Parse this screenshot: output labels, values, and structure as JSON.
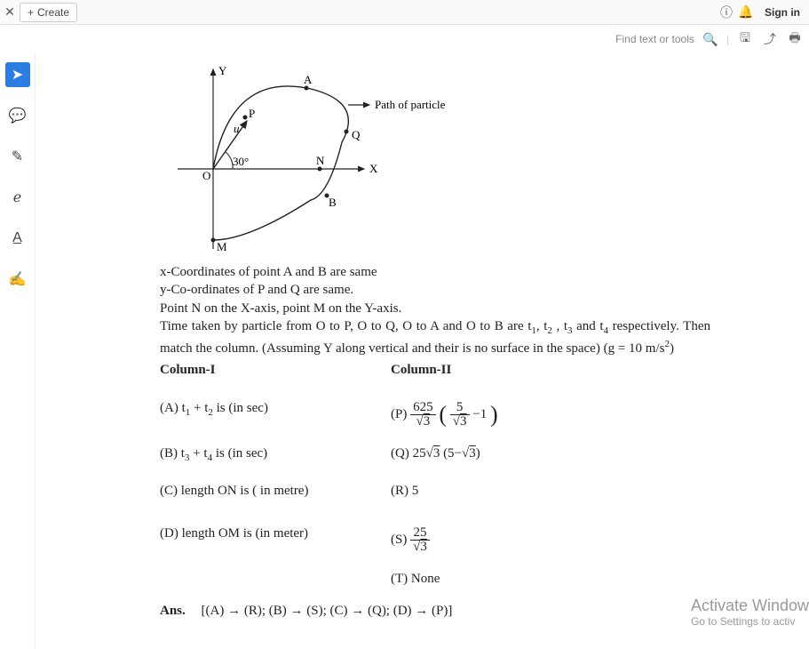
{
  "topbar": {
    "create_label": "Create",
    "signin_label": "Sign in"
  },
  "toolsbar": {
    "find_placeholder": "Find text or tools"
  },
  "diagram": {
    "axis_y": "Y",
    "axis_x": "X",
    "point_A": "A",
    "point_B": "B",
    "point_P": "P",
    "point_Q": "Q",
    "point_N": "N",
    "point_M": "M",
    "point_O": "O",
    "vec_u": "u",
    "angle": "30°",
    "path_label": "Path of particle"
  },
  "body": {
    "line1": "x-Coordinates of point A and B are same",
    "line2": "y-Co-ordinates of P and Q are same.",
    "line3": "Point N on the X-axis, point M on the Y-axis.",
    "line4_a": "Time taken by particle from O to P, O to Q, O to A and O to B are t",
    "line4_b": ", t",
    "line4_c": " , t",
    "line4_d": " and t",
    "line4_e": " respectively. Then match the column. (Assuming Y along vertical and their is no surface in the space) (g = 10 m/s",
    "line4_f": ")",
    "sub1": "1",
    "sub2": "2",
    "sub3": "3",
    "sub4": "4",
    "sup2": "2"
  },
  "columns": {
    "h1": "Column-I",
    "h2": "Column-II",
    "A_pre": "(A) t",
    "A_mid": " + t",
    "A_post": " is (in sec)",
    "B_pre": "(B) t",
    "B_mid": " + t",
    "B_post": " is (in sec)",
    "C": "(C) length ON is ( in metre)",
    "D": "(D) length OM is (in meter)",
    "P_lead": "(P) ",
    "P_num": "625",
    "P_den_root": "3",
    "P_inner_num": "5",
    "P_inner_den_root": "3",
    "P_tail": "−1",
    "Q_lead": "(Q) 25",
    "Q_root": "3",
    "Q_tail_open": " (5−",
    "Q_tail_root": "3",
    "Q_tail_close": ")",
    "R": "(R) 5",
    "S_lead": "(S) ",
    "S_num": "25",
    "S_den_root": "3",
    "T": "(T) None"
  },
  "answer": {
    "label": "Ans.",
    "text": "[(A) → (R);   (B) → (S);   (C) → (Q);   (D) → (P)]"
  },
  "watermark": {
    "line1": "Activate Window",
    "line2": "Go to Settings to activ"
  }
}
